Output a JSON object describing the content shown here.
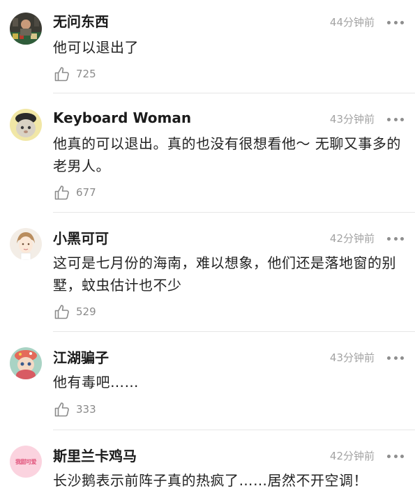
{
  "colors": {
    "text_primary": "#1b1b1b",
    "text_secondary": "#a3a3a3",
    "divider": "#e6e6e6",
    "avatar_pink": "#fbd3df"
  },
  "comments": [
    {
      "username": "无问东西",
      "time": "44分钟前",
      "text": "他可以退出了",
      "likes": "725",
      "avatar": "photo-avatar"
    },
    {
      "username": "Keyboard Woman",
      "time": "43分钟前",
      "text": "他真的可以退出。真的也没有很想看他～ 无聊又事多的老男人。",
      "likes": "677",
      "avatar": "cat-avatar"
    },
    {
      "username": "小黑可可",
      "time": "42分钟前",
      "text": "这可是七月份的海南，难以想象，他们还是落地窗的别墅，蚊虫估计也不少",
      "likes": "529",
      "avatar": "cartoon-avatar"
    },
    {
      "username": "江湖骗子",
      "time": "43分钟前",
      "text": "他有毒吧……",
      "likes": "333",
      "avatar": "cat-doll-avatar"
    },
    {
      "username": "斯里兰卡鸡马",
      "time": "42分钟前",
      "text": "长沙鹅表示前阵子真的热疯了……居然不开空调！",
      "likes": "",
      "avatar": "pink-text-avatar",
      "avatar_text": "我甜可爱"
    }
  ],
  "icons": {
    "like": "thumbs-up-icon",
    "more": "more-dots-icon"
  }
}
